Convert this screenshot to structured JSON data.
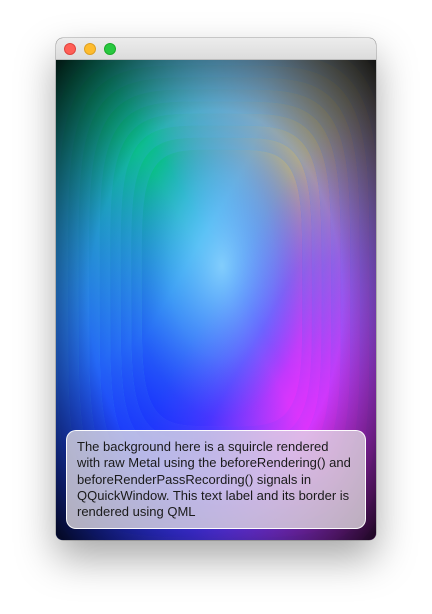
{
  "window": {
    "title": "",
    "buttons": [
      "close",
      "minimize",
      "zoom"
    ],
    "colors": {
      "close": "#ff5f57",
      "minimize": "#febc2e",
      "zoom": "#28c840"
    }
  },
  "background": {
    "shape": "squircle",
    "colors": {
      "top_left": "#00c878",
      "top_right": "#c8b464",
      "center": "#78d2ff",
      "bottom_left": "#1e28ff",
      "bottom_right": "#e628ff"
    }
  },
  "label": {
    "text": "The background here is a squircle rendered with raw Metal using the beforeRendering() and beforeRenderPassRecording() signals in QQuickWindow. This text label and its border is rendered using QML"
  }
}
